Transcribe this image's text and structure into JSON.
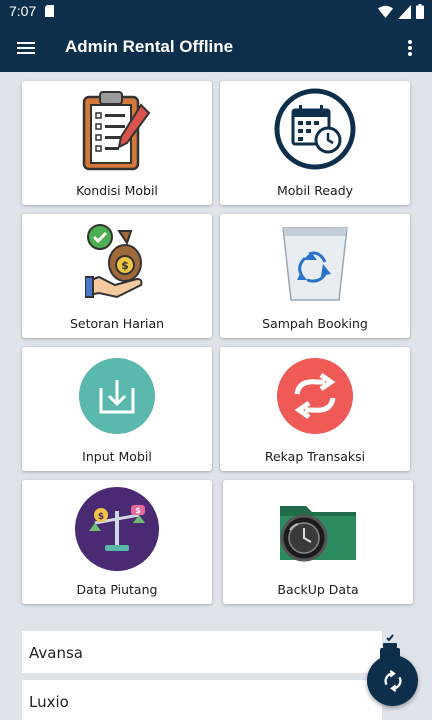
{
  "status_bar": {
    "time": "7:07"
  },
  "app_bar": {
    "title": "Admin Rental Offline"
  },
  "menu": [
    {
      "label": "Kondisi Mobil",
      "icon": "clipboard-checklist-icon"
    },
    {
      "label": "Mobil Ready",
      "icon": "calendar-clock-icon"
    },
    {
      "label": "Setoran Harian",
      "icon": "money-bag-hand-icon"
    },
    {
      "label": "Sampah Booking",
      "icon": "recycle-bin-icon"
    },
    {
      "label": "Input Mobil",
      "icon": "download-icon"
    },
    {
      "label": "Rekap Transaksi",
      "icon": "sync-arrows-icon"
    },
    {
      "label": "Data Piutang",
      "icon": "scale-coins-icon"
    },
    {
      "label": "BackUp Data",
      "icon": "backup-folder-icon"
    }
  ],
  "car_list": [
    "Avansa",
    "Luxio"
  ],
  "colors": {
    "primary": "#0e2f4c",
    "background": "#dfe3ea",
    "teal": "#5ab8ad",
    "coral": "#ef5a57",
    "purple": "#4b2a74"
  }
}
